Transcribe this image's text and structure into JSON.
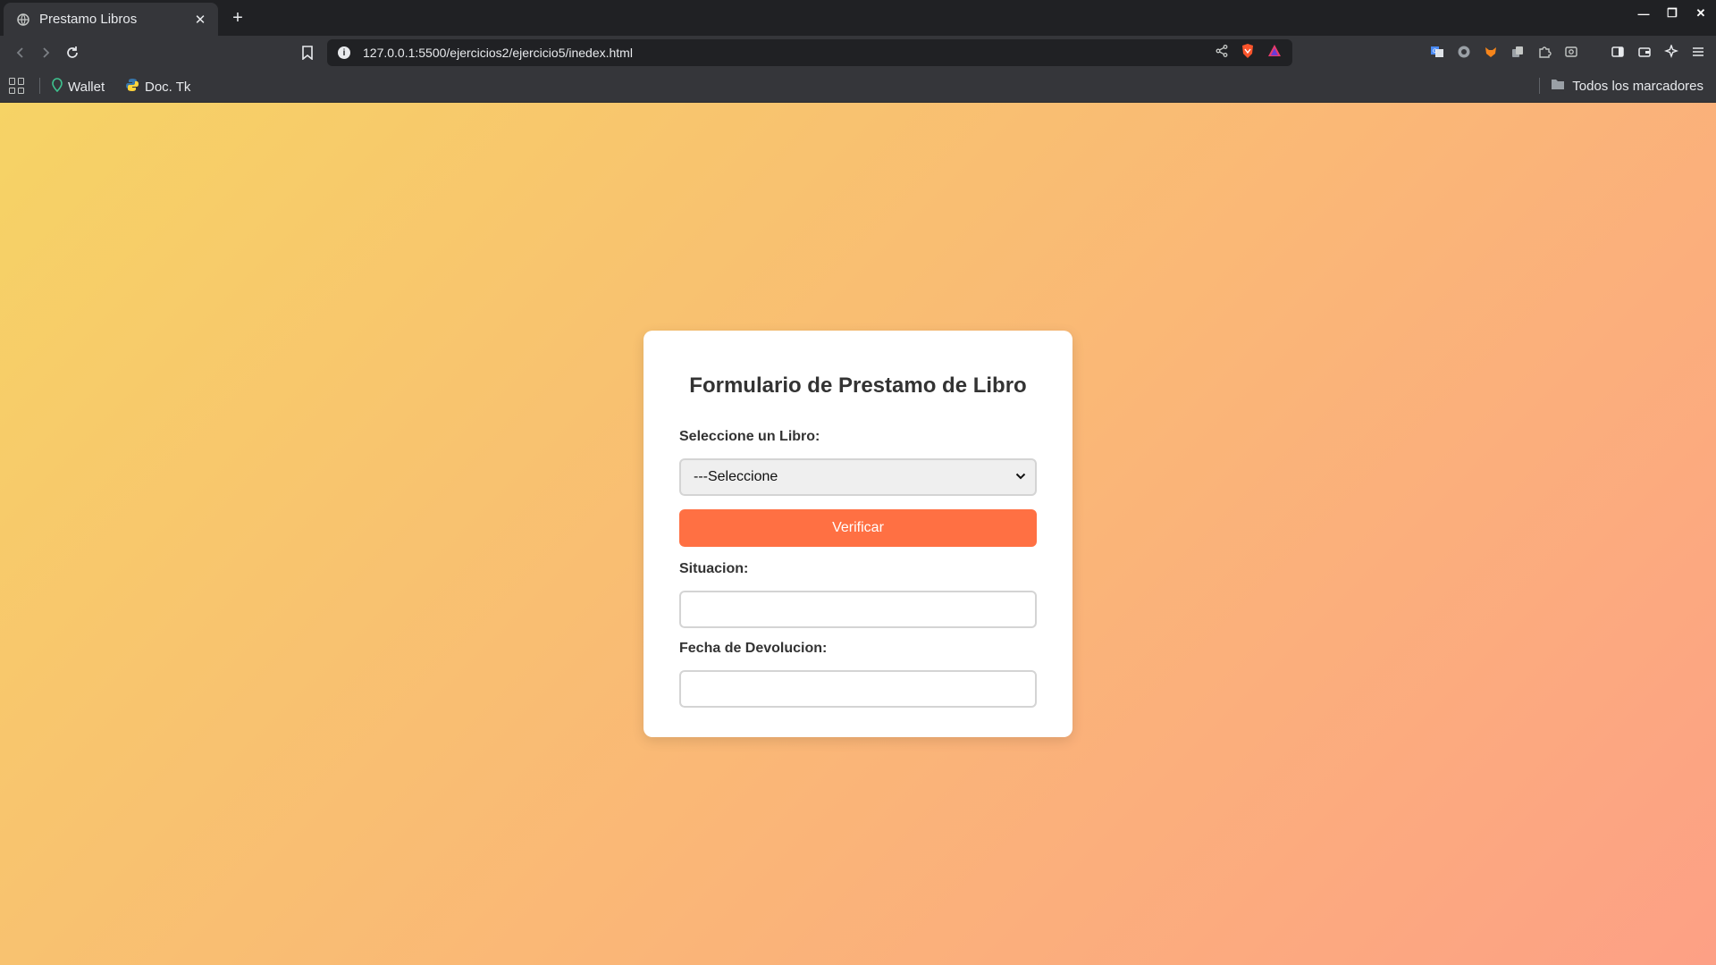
{
  "browser": {
    "tab_title": "Prestamo Libros",
    "tab_close": "✕",
    "new_tab": "+",
    "url": "127.0.0.1:5500/ejercicios2/ejercicio5/inedex.html",
    "bookmarks": [
      {
        "label": "Wallet",
        "icon": "wallet-icon"
      },
      {
        "label": "Doc. Tk",
        "icon": "python-icon"
      }
    ],
    "all_bookmarks_label": "Todos los marcadores"
  },
  "form": {
    "title": "Formulario de Prestamo de Libro",
    "book_label": "Seleccione un Libro:",
    "book_selected": "---Seleccione",
    "verify_button": "Verificar",
    "status_label": "Situacion:",
    "status_value": "",
    "return_date_label": "Fecha de Devolucion:",
    "return_date_value": ""
  },
  "colors": {
    "gradient_start": "#f6d365",
    "gradient_end": "#fda085",
    "button": "#ff7043"
  }
}
